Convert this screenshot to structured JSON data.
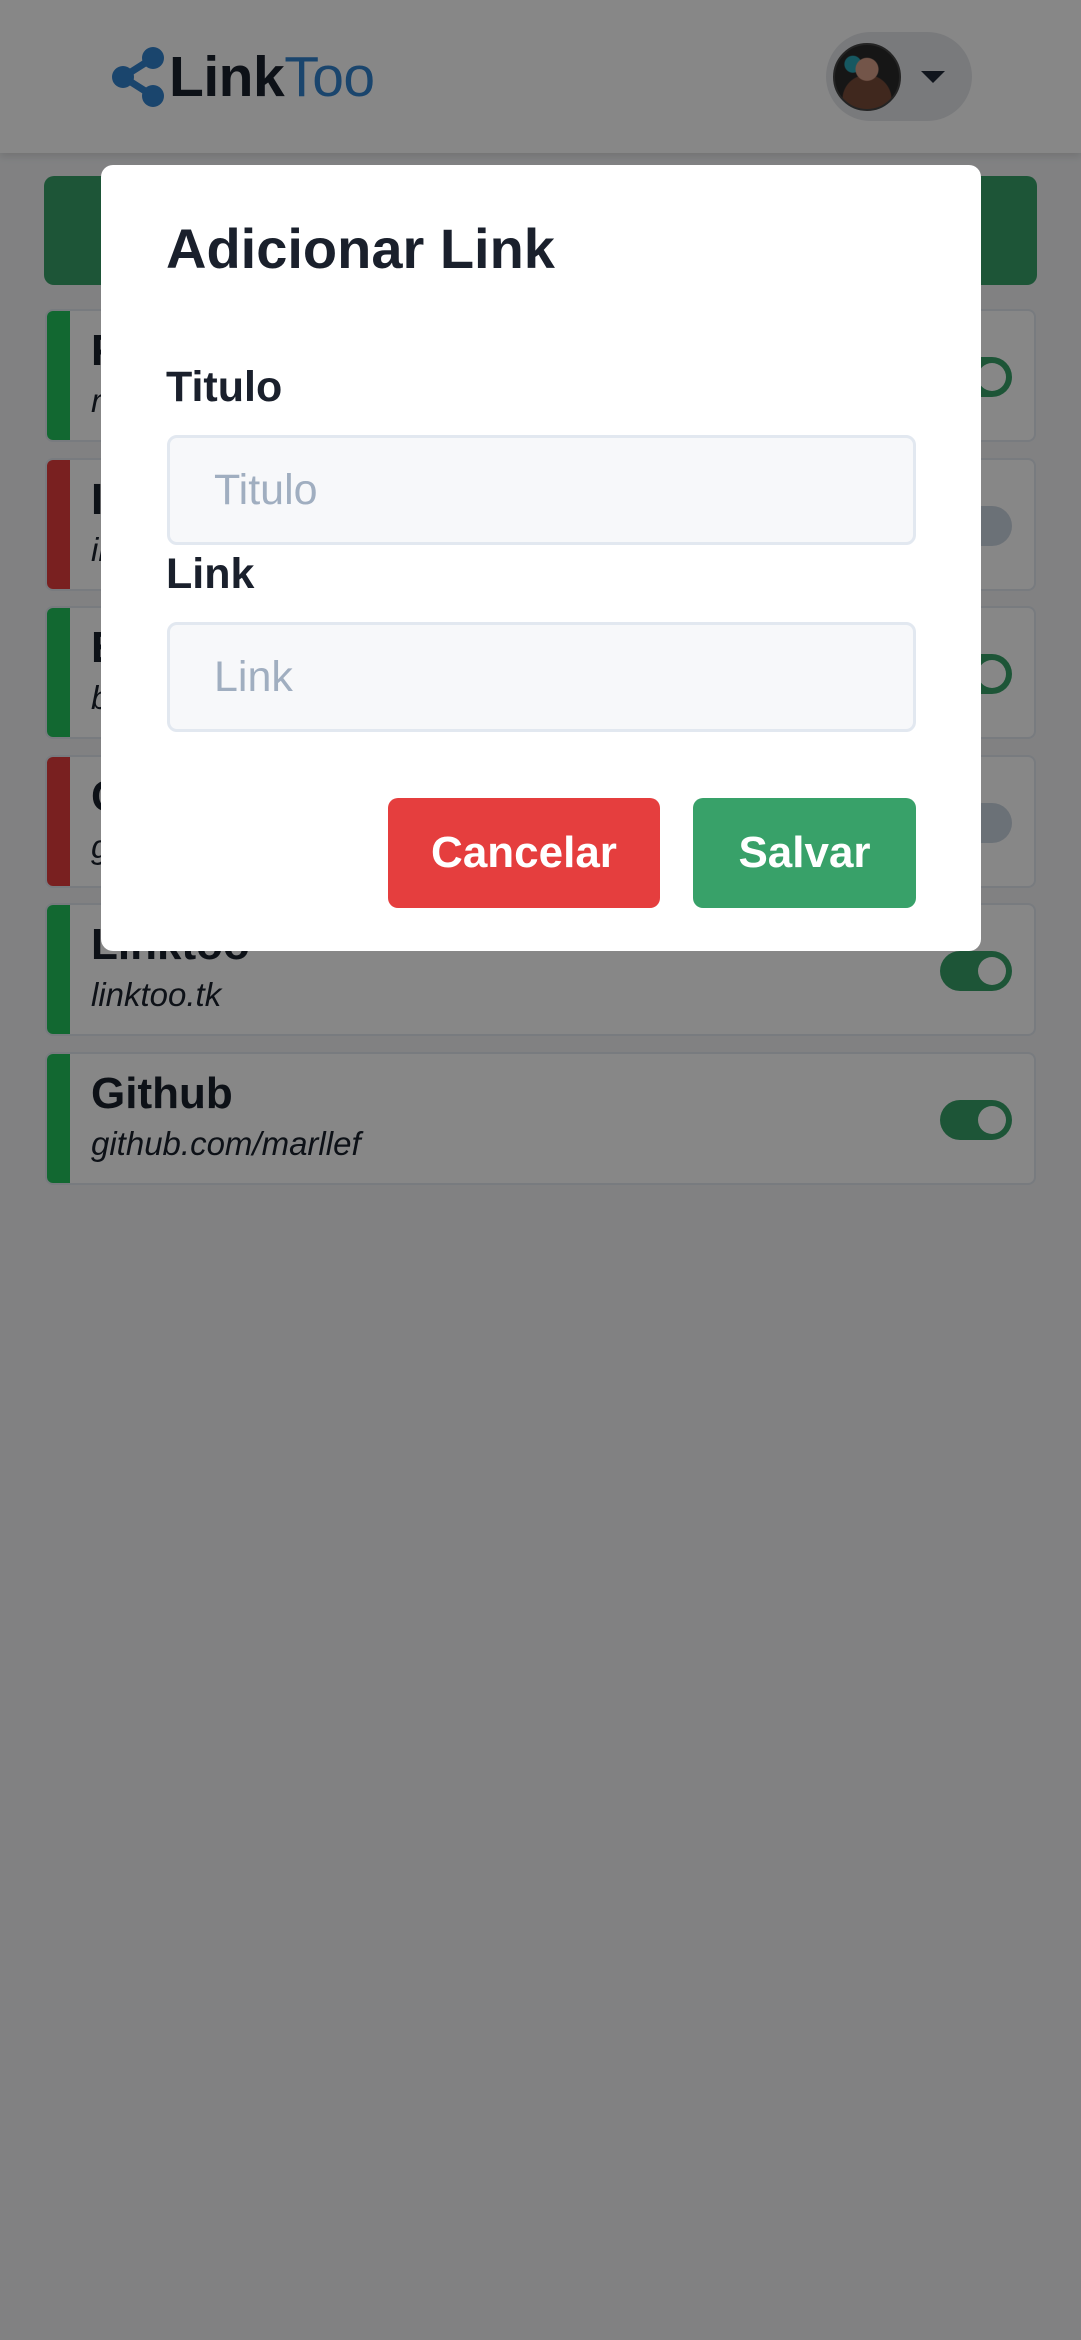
{
  "app": {
    "name_primary": "Link",
    "name_accent": "Too",
    "accent_color": "#3182ce"
  },
  "links": [
    {
      "title": "P",
      "url": "m",
      "enabled": true
    },
    {
      "title": "I",
      "url": "in",
      "enabled": false
    },
    {
      "title": "E",
      "url": "b",
      "enabled": true
    },
    {
      "title": "C",
      "url": "g",
      "enabled": false
    },
    {
      "title": "Linktoo",
      "url": "linktoo.tk",
      "enabled": true
    },
    {
      "title": "Github",
      "url": "github.com/marllef",
      "enabled": true
    }
  ],
  "modal": {
    "title": "Adicionar Link",
    "title_field": {
      "label": "Titulo",
      "placeholder": "Titulo",
      "value": ""
    },
    "link_field": {
      "label": "Link",
      "placeholder": "Link",
      "value": ""
    },
    "cancel_label": "Cancelar",
    "save_label": "Salvar"
  },
  "colors": {
    "enabled": "#22c55e",
    "disabled": "#e53e3e",
    "primary_button": "#38a169",
    "danger_button": "#e53e3e"
  },
  "icons": {
    "logo": "share-nodes-icon",
    "user_menu": "chevron-down-icon"
  }
}
